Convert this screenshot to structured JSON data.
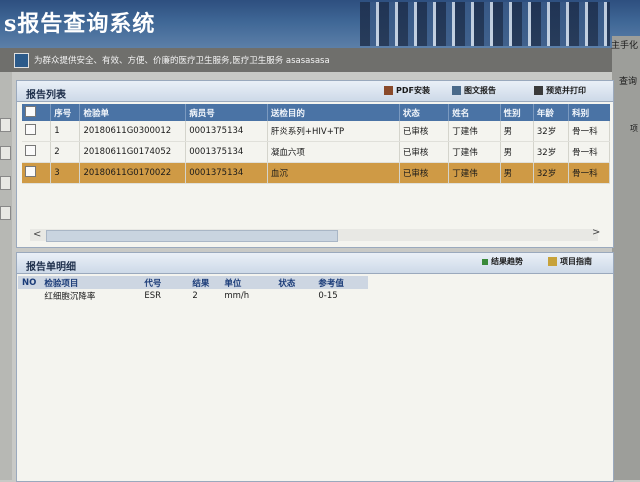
{
  "app": {
    "title": "s报告查询系统",
    "subtitle": "为群众提供安全、有效、方便、价廉的医疗卫生服务,医疗卫生服务 asasasasa"
  },
  "right_strip": {
    "text1": "主手化",
    "text2": "查询",
    "text3": "项"
  },
  "report_list": {
    "title": "报告列表",
    "toolbar": {
      "pdf_install": "PDF安装",
      "image_report": "图文报告",
      "preview_print": "预览并打印"
    },
    "columns": [
      "序号",
      "检验单",
      "病员号",
      "送检目的",
      "状态",
      "姓名",
      "性别",
      "年龄",
      "科别"
    ],
    "rows": [
      {
        "no": "1",
        "sample": "20180611G0300012",
        "patient_id": "0001375134",
        "purpose": "肝炎系列+HIV+TP",
        "status": "已审核",
        "name": "丁建伟",
        "sex": "男",
        "age": "32岁",
        "dept": "骨一科"
      },
      {
        "no": "2",
        "sample": "20180611G0174052",
        "patient_id": "0001375134",
        "purpose": "凝血六项",
        "status": "已审核",
        "name": "丁建伟",
        "sex": "男",
        "age": "32岁",
        "dept": "骨一科"
      },
      {
        "no": "3",
        "sample": "20180611G0170022",
        "patient_id": "0001375134",
        "purpose": "血沉",
        "status": "已审核",
        "name": "丁建伟",
        "sex": "男",
        "age": "32岁",
        "dept": "骨一科"
      }
    ],
    "selected_row": 3,
    "scroll_left": "<",
    "scroll_right": ">"
  },
  "report_detail": {
    "title": "报告单明细",
    "toolbar": {
      "trend": "结果趋势",
      "guide": "项目指南"
    },
    "columns": [
      "NO",
      "检验项目",
      "代号",
      "结果",
      "单位",
      "状态",
      "参考值"
    ],
    "rows": [
      {
        "no": "",
        "item": "红细胞沉降率",
        "code": "ESR",
        "result": "2",
        "unit": "mm/h",
        "status": "",
        "ref": "0-15"
      }
    ]
  },
  "colors": {
    "header": "#3f6796",
    "grid_header": "#4a73a5",
    "selected_row": "#cf9a45"
  }
}
